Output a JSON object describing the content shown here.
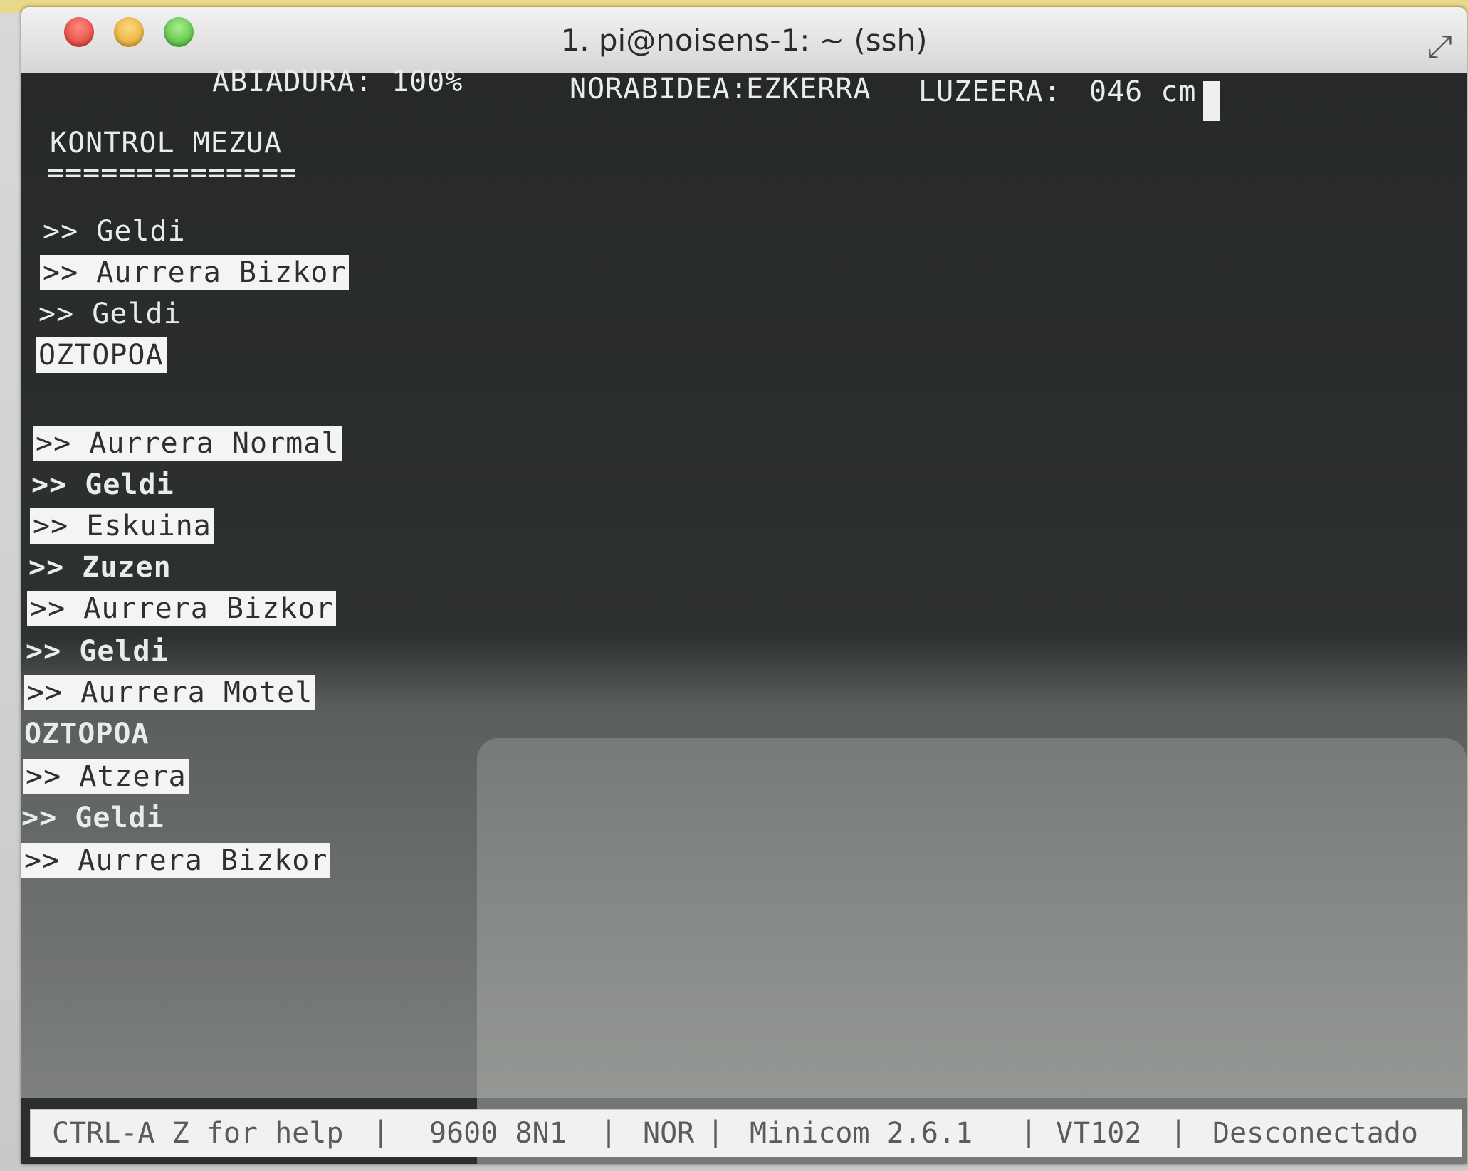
{
  "window": {
    "title": "1. pi@noisens-1: ~ (ssh)"
  },
  "header": {
    "speed_label": "ABIADURA:",
    "speed_value": "100%",
    "direction_label": "NORABIDEA:",
    "direction_value": "EZKERRA",
    "distance_label": "LUZEERA:",
    "distance_value": "046 cm"
  },
  "section": {
    "title": "KONTROL MEZUA",
    "underline": "=============="
  },
  "messages": [
    {
      "text": ">> Geldi",
      "highlight": false,
      "bold": false
    },
    {
      "text": ">> Aurrera Bizkor",
      "highlight": true,
      "bold": false
    },
    {
      "text": ">> Geldi",
      "highlight": false,
      "bold": false
    },
    {
      "text": "OZTOPOA",
      "highlight": true,
      "bold": false
    },
    {
      "text": ">> Aurrera Normal",
      "highlight": true,
      "bold": false
    },
    {
      "text": ">> Geldi",
      "highlight": false,
      "bold": true
    },
    {
      "text": ">> Eskuina",
      "highlight": true,
      "bold": false
    },
    {
      "text": ">> Zuzen",
      "highlight": false,
      "bold": true
    },
    {
      "text": ">> Aurrera Bizkor",
      "highlight": true,
      "bold": false
    },
    {
      "text": ">> Geldi",
      "highlight": false,
      "bold": true
    },
    {
      "text": ">> Aurrera Motel",
      "highlight": true,
      "bold": false
    },
    {
      "text": "OZTOPOA",
      "highlight": false,
      "bold": true
    },
    {
      "text": ">> Atzera",
      "highlight": true,
      "bold": false
    },
    {
      "text": ">> Geldi",
      "highlight": false,
      "bold": true
    },
    {
      "text": ">> Aurrera Bizkor",
      "highlight": true,
      "bold": false
    }
  ],
  "statusbar": {
    "help": "CTRL-A Z for help",
    "baud": "9600 8N1",
    "mode": "NOR",
    "app": "Minicom 2.6.1",
    "term": "VT102",
    "conn": "Desconectado"
  },
  "colors": {
    "terminal_bg": "#2b2d2e",
    "text": "#e9ecec",
    "highlight_bg": "#f4f5f2",
    "statusbar_bg": "#f1f2ef"
  }
}
